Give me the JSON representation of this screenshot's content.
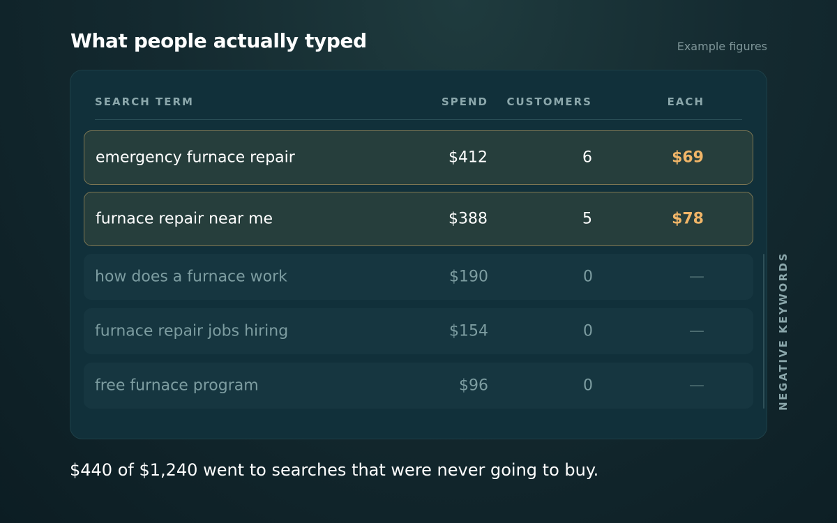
{
  "header": {
    "title": "What people actually typed",
    "note": "Example figures"
  },
  "table": {
    "columns": {
      "term": "SEARCH TERM",
      "spend": "SPEND",
      "customers": "CUSTOMERS",
      "each": "EACH"
    },
    "rows": [
      {
        "term": "emergency furnace repair",
        "spend": "$412",
        "customers": "6",
        "each": "$69",
        "status": "converting"
      },
      {
        "term": "furnace repair near me",
        "spend": "$388",
        "customers": "5",
        "each": "$78",
        "status": "converting"
      },
      {
        "term": "how does a furnace work",
        "spend": "$190",
        "customers": "0",
        "each": "—",
        "status": "negative"
      },
      {
        "term": "furnace repair jobs hiring",
        "spend": "$154",
        "customers": "0",
        "each": "—",
        "status": "negative"
      },
      {
        "term": "free furnace program",
        "spend": "$96",
        "customers": "0",
        "each": "—",
        "status": "negative"
      }
    ],
    "side_label": "NEGATIVE KEYWORDS"
  },
  "footer": {
    "text": "$440 of $1,240 went to searches that were never going to buy."
  },
  "colors": {
    "accent": "#f0b568",
    "highlight_border": "#7e7753",
    "muted_text": "#7d9da1"
  }
}
